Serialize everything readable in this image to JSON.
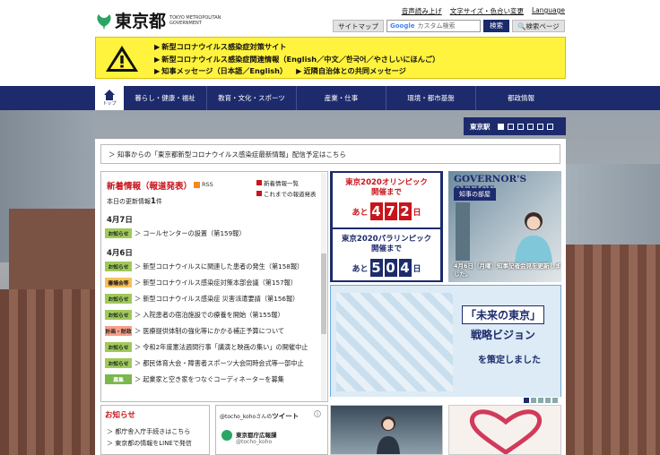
{
  "header": {
    "logo_text": "東京都",
    "logo_sub": "TOKYO METROPOLITAN GOVERNMENT",
    "util_links": [
      "音声読み上げ",
      "文字サイズ・色合い変更",
      "Language"
    ],
    "sitemap_label": "サイトマップ",
    "search_placeholder": "カスタム検索",
    "search_google": "Google",
    "search_button": "検索",
    "search_page_button": "検索ページ"
  },
  "notice": {
    "links": [
      "新型コロナウイルス感染症対策サイト",
      "新型コロナウイルス感染症関連情報（English／中文／한국어／やさしいにほんご）",
      "知事メッセージ（日本語／English）",
      "近隣自治体との共同メッセージ"
    ]
  },
  "nav": {
    "home_label": "トップ",
    "items": [
      "暮らし・健康・福祉",
      "教育・文化・スポーツ",
      "産業・仕事",
      "環境・都市基盤",
      "都政情報"
    ]
  },
  "station": {
    "label": "東京駅"
  },
  "banner": "知事からの「東京都新型コロナウイルス感染症最新情報」配信予定はこちら",
  "news": {
    "title": "新着情報（報道発表）",
    "rss": "RSS",
    "side_links": [
      "新着情報一覧",
      "これまでの報道発表"
    ],
    "count_label": "本日の更新情報",
    "count_value": "1",
    "count_unit": "件",
    "dates": [
      "4月7日",
      "4月6日"
    ],
    "items": [
      {
        "tag": "お知らせ",
        "tagclass": "tag-g",
        "text": "コールセンターの設置（第159報）"
      },
      {
        "tag": "お知らせ",
        "tagclass": "tag-g",
        "text": "新型コロナウイルスに関連した患者の発生（第158報）"
      },
      {
        "tag": "審議会等",
        "tagclass": "tag-o",
        "text": "新型コロナウイルス感染症対策本部会議（第157報）"
      },
      {
        "tag": "お知らせ",
        "tagclass": "tag-g",
        "text": "新型コロナウイルス感染症 災害派遣要請（第156報）"
      },
      {
        "tag": "お知らせ",
        "tagclass": "tag-g",
        "text": "入院患者の宿泊施設での療養を開始（第155報）"
      },
      {
        "tag": "計画・財政",
        "tagclass": "tag-r",
        "text": "医療提供体制の強化等にかかる補正予算について"
      },
      {
        "tag": "お知らせ",
        "tagclass": "tag-g",
        "text": "令和2年度憲法週間行事「講演と映画の集い」の開催中止"
      },
      {
        "tag": "お知らせ",
        "tagclass": "tag-g",
        "text": "都民体育大会・障害者スポーツ大会同時会式等一部中止"
      },
      {
        "tag": "募集",
        "tagclass": "tag-d",
        "text": "起業家と空き家をつなぐコーディネーターを募集"
      }
    ]
  },
  "olympic": {
    "title": "東京2020オリンピック",
    "subtitle": "開催まで",
    "prefix": "あと",
    "digits": [
      "4",
      "7",
      "2"
    ],
    "suffix": "日"
  },
  "paralympic": {
    "title": "東京2020パラリンピック",
    "subtitle": "開催まで",
    "prefix": "あと",
    "digits": [
      "5",
      "0",
      "4"
    ],
    "suffix": "日"
  },
  "governor": {
    "title": "GOVERNOR'S OFFICE",
    "room": "知事の部屋",
    "caption": "4月6日（月曜）知事記者会見を更新しました。"
  },
  "vision": {
    "line1": "「未来の東京」",
    "line2": "戦略ビジョン",
    "line3": "を策定しました"
  },
  "oshirase": {
    "title": "お知らせ",
    "items": [
      "都庁舎入庁手続きはこちら",
      "東京都の情報をLINEで発信"
    ]
  },
  "tweet": {
    "title_handle": "@tocho_koho",
    "title_suffix": "さんのツイート",
    "account_name": "東京都庁広報課",
    "account_handle": "@tocho_koho"
  },
  "colors": {
    "navy": "#1d2b6c",
    "red": "#c8151b",
    "notice_yellow": "#fff33d",
    "logo_green": "#2aa564"
  }
}
